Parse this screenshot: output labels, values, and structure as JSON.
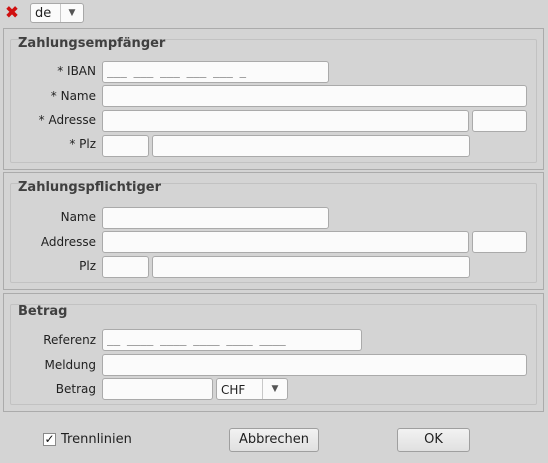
{
  "toolbar": {
    "close_icon": "close-icon",
    "language": "de"
  },
  "payee": {
    "title": "Zahlungsempfänger",
    "iban_label": "* IBAN",
    "iban_value": "___ ___ ___ ___ ___ _",
    "name_label": "* Name",
    "address_label": "* Adresse",
    "plz_label": "* Plz"
  },
  "payer": {
    "title": "Zahlungspflichtiger",
    "name_label": "Name",
    "address_label": "Addresse",
    "plz_label": "Plz"
  },
  "amount": {
    "title": "Betrag",
    "reference_label": "Referenz",
    "reference_value": "__ ____ ____ ____ ____ ____",
    "message_label": "Meldung",
    "amount_label": "Betrag",
    "currency": "CHF"
  },
  "footer": {
    "checkbox_label": "Trennlinien",
    "checkbox_checked": true,
    "cancel_label": "Abbrechen",
    "ok_label": "OK"
  },
  "colors": {
    "background": "#d4d4d4",
    "close_icon": "#d01010"
  }
}
